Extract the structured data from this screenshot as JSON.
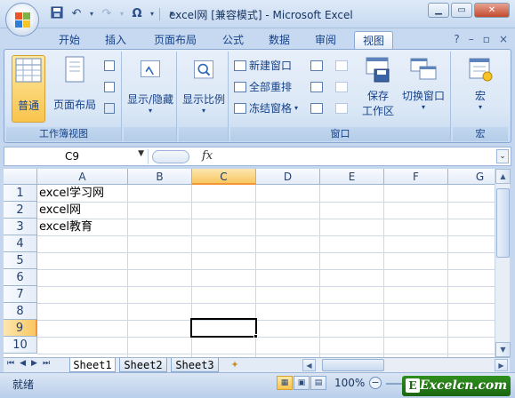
{
  "window": {
    "title": "excel网 [兼容模式] - Microsoft Excel"
  },
  "qat": {
    "icons": [
      "save-icon",
      "undo-icon",
      "redo-icon",
      "symbol-icon"
    ],
    "symbol_glyph": "Ω"
  },
  "tabs": [
    {
      "label": "开始"
    },
    {
      "label": "插入"
    },
    {
      "label": "页面布局"
    },
    {
      "label": "公式"
    },
    {
      "label": "数据"
    },
    {
      "label": "审阅"
    },
    {
      "label": "视图"
    }
  ],
  "active_tab": "视图",
  "ribbon": {
    "workbook_views": {
      "label": "工作簿视图",
      "normal": "普通",
      "page_layout": "页面布局"
    },
    "show_hide": {
      "label": "显示/隐藏"
    },
    "zoom": {
      "label": "显示比例"
    },
    "window": {
      "label": "窗口",
      "new_window": "新建窗口",
      "arrange_all": "全部重排",
      "freeze_panes": "冻结窗格",
      "save_workspace": "保存\n工作区",
      "save_workspace_l1": "保存",
      "save_workspace_l2": "工作区",
      "switch_windows": "切换窗口"
    },
    "macros": {
      "label": "宏",
      "button": "宏"
    }
  },
  "formula_bar": {
    "name_box": "C9",
    "fx": "fx",
    "value": ""
  },
  "grid": {
    "columns": [
      "A",
      "B",
      "C",
      "D",
      "E",
      "F",
      "G"
    ],
    "rows": [
      "1",
      "2",
      "3",
      "4",
      "5",
      "6",
      "7",
      "8",
      "9",
      "10"
    ],
    "selected_column": "C",
    "selected_row": "9",
    "cells": {
      "A1": "excel学习网",
      "A2": "excel网",
      "A3": "excel教育"
    }
  },
  "sheets": {
    "tabs": [
      "Sheet1",
      "Sheet2",
      "Sheet3"
    ],
    "active": "Sheet1"
  },
  "status": {
    "text": "就绪",
    "zoom": "100%"
  },
  "watermark": {
    "text": "Excelcn.com",
    "badge": "E"
  },
  "colors": {
    "accent": "#f8c862",
    "ribbon_bg": "#dce8f6",
    "text": "#15428b"
  }
}
